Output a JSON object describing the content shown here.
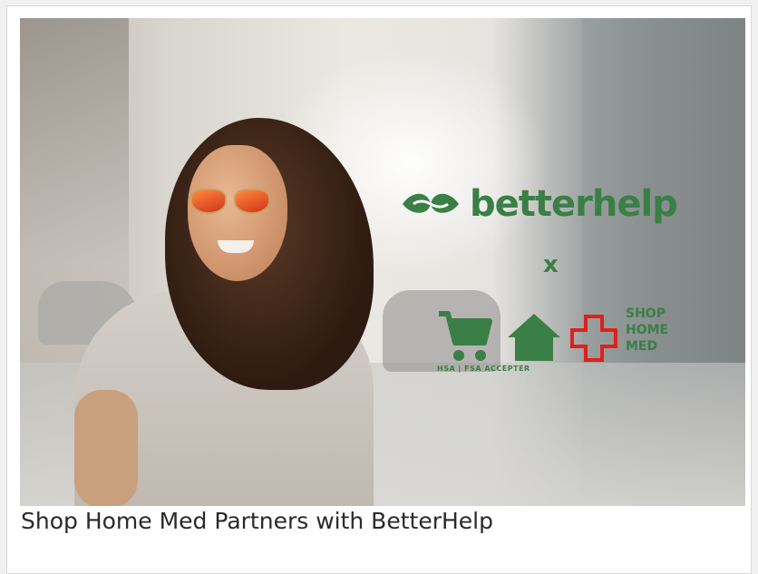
{
  "hero": {
    "brand_text": "betterhelp",
    "connector": "x",
    "badge_text": "HSA | FSA ACCEPTER",
    "shop_lines": [
      "SHOP",
      "HOME",
      "MED"
    ]
  },
  "caption": "Shop Home Med Partners with BetterHelp",
  "colors": {
    "brand_green": "#3a7f45",
    "cross_red": "#e0201c"
  },
  "icons": [
    "betterhelp-leaf-icon",
    "shopping-cart-icon",
    "house-icon",
    "medical-cross-icon"
  ]
}
